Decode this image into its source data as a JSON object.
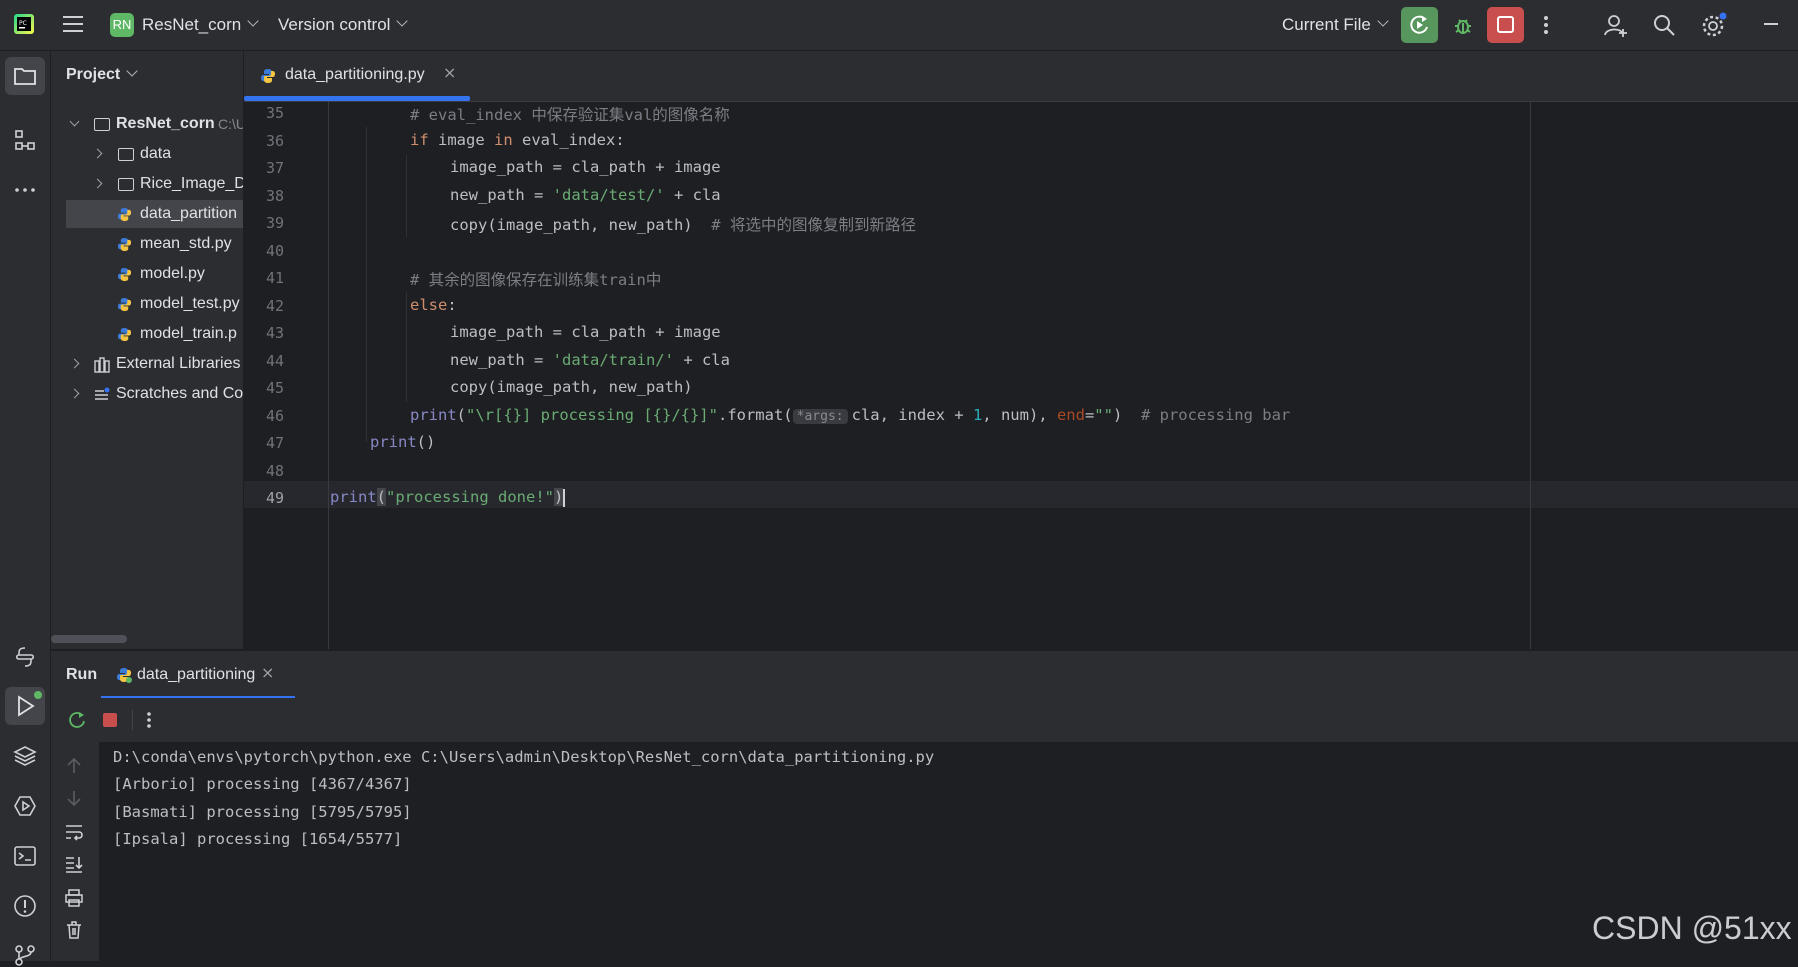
{
  "toolbar": {
    "project_badge": "RN",
    "project_name": "ResNet_corn",
    "version_control": "Version control",
    "run_config": "Current File"
  },
  "project_panel": {
    "title": "Project",
    "root": {
      "name": "ResNet_corn",
      "path": "C:\\U"
    },
    "items": [
      {
        "label": "data"
      },
      {
        "label": "Rice_Image_D"
      },
      {
        "label": "data_partition"
      },
      {
        "label": "mean_std.py"
      },
      {
        "label": "model.py"
      },
      {
        "label": "model_test.py"
      },
      {
        "label": "model_train.p"
      },
      {
        "label": "External Libraries"
      },
      {
        "label": "Scratches and Co"
      }
    ]
  },
  "editor": {
    "tab_label": "data_partitioning.py",
    "line_numbers": [
      "35",
      "36",
      "37",
      "38",
      "39",
      "40",
      "41",
      "42",
      "43",
      "44",
      "45",
      "46",
      "47",
      "48",
      "49"
    ],
    "l35_comment": "# eval_index 中保存验证集val的图像名称",
    "l36": {
      "kw_if": "if",
      "a": " image ",
      "kw_in": "in",
      "b": " eval_index:"
    },
    "l37": "image_path = cla_path + image",
    "l38": {
      "a": "new_path = ",
      "s": "'data/test/'",
      "b": " + cla"
    },
    "l39": {
      "a": "copy(image_path, new_path)  ",
      "c": "# 将选中的图像复制到新路径"
    },
    "l41_comment": "# 其余的图像保存在训练集train中",
    "l42": {
      "kw": "else",
      "b": ":"
    },
    "l43": "image_path = cla_path + image",
    "l44": {
      "a": "new_path = ",
      "s": "'data/train/'",
      "b": " + cla"
    },
    "l45": "copy(image_path, new_path)",
    "l46": {
      "fn": "print",
      "p1": "(",
      "s": "\"\\r[{}] processing [{}/{}]\"",
      "b": ".format(",
      "hint": "*args:",
      "c": "cla, index + ",
      "n": "1",
      "d": ", num), ",
      "kwarg": "end",
      "e": "=",
      "s2": "\"\"",
      "f": ")  ",
      "cm": "# processing bar"
    },
    "l47": {
      "fn": "print",
      "b": "()"
    },
    "l49": {
      "fn": "print",
      "s": "\"processing done!\"",
      "p_open": "(",
      "p_close": ")"
    }
  },
  "run_panel": {
    "title": "Run",
    "tab_label": "data_partitioning",
    "output": [
      "D:\\conda\\envs\\pytorch\\python.exe C:\\Users\\admin\\Desktop\\ResNet_corn\\data_partitioning.py",
      "[Arborio] processing [4367/4367]",
      "[Basmati] processing [5795/5795]",
      "[Ipsala] processing [1654/5577]"
    ]
  },
  "watermark": "CSDN @51xx",
  "colors": {
    "accent": "#3574f0",
    "run_green": "#57965c",
    "stop_red": "#c94f4f"
  }
}
